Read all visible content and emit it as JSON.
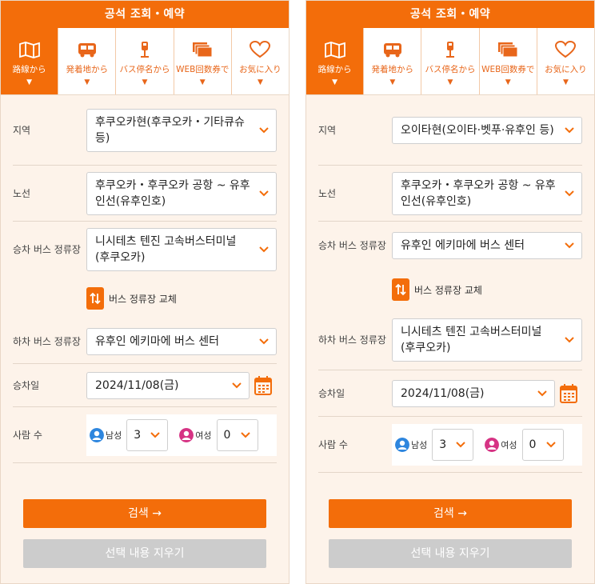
{
  "colors": {
    "accent": "#f36d0a",
    "male": "#2e86de",
    "female": "#d63384",
    "clear_button": "#cccccc"
  },
  "header": {
    "title": "공석 조회・예약"
  },
  "tabs": [
    {
      "label": "路線から",
      "caret": "▼",
      "icon": "map-icon"
    },
    {
      "label": "発着地から",
      "caret": "▼",
      "icon": "bus-icon"
    },
    {
      "label": "バス停名から",
      "caret": "▼",
      "icon": "bus-stop-icon"
    },
    {
      "label": "WEB回数券で",
      "caret": "▼",
      "icon": "ticket-icon"
    },
    {
      "label": "お気に入り",
      "caret": "▼",
      "icon": "heart-icon"
    }
  ],
  "labels": {
    "region": "지역",
    "route": "노선",
    "boarding_stop": "승차 버스 정류장",
    "alighting_stop": "하차 버스 정류장",
    "date": "승차일",
    "people": "사람 수",
    "male": "남성",
    "female": "여성",
    "swap": "버스 정류장 교체",
    "search": "검색",
    "search_arrow": "→",
    "clear": "선택 내용 지우기"
  },
  "left": {
    "region": "후쿠오카현(후쿠오카・기타큐슈 등)",
    "route": "후쿠오카・후쿠오카 공항 ~ 유후인선(유후인호)",
    "boarding_stop": "니시테츠 텐진 고속버스터미널 (후쿠오카)",
    "alighting_stop": "유후인 에키마에 버스 센터",
    "date": "2024/11/08(금)",
    "male_count": "3",
    "female_count": "0"
  },
  "right": {
    "region": "오이타현(오이타·벳푸·유후인 등)",
    "route": "후쿠오카・후쿠오카 공항 ~ 유후인선(유후인호)",
    "boarding_stop": "유후인 에키마에 버스 센터",
    "alighting_stop": "니시테츠 텐진 고속버스터미널 (후쿠오카)",
    "date": "2024/11/08(금)",
    "male_count": "3",
    "female_count": "0"
  }
}
